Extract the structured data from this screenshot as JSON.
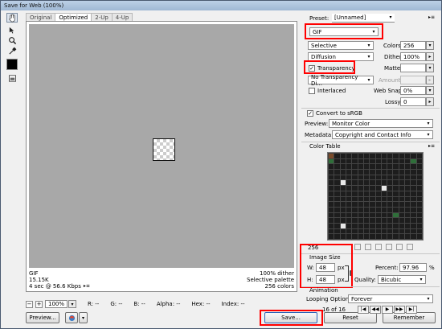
{
  "window": {
    "title": "Save for Web (100%)"
  },
  "tabs": [
    {
      "label": "Original"
    },
    {
      "label": "Optimized"
    },
    {
      "label": "2-Up"
    },
    {
      "label": "4-Up"
    }
  ],
  "info": {
    "format": "GIF",
    "size": "15.15K",
    "time": "4 sec @ 56.6 Kbps",
    "menu_glyph": "▸≡",
    "dither": "100% dither",
    "palette": "Selective palette",
    "colors": "256 colors"
  },
  "status": {
    "zoom": "100%",
    "r": "R: --",
    "g": "G: --",
    "b": "B: --",
    "alpha": "Alpha: --",
    "hex": "Hex: --",
    "index": "Index: --"
  },
  "buttons": {
    "preview": "Preview...",
    "save": "Save...",
    "reset": "Reset",
    "remember": "Remember"
  },
  "settings": {
    "preset_label": "Preset:",
    "preset_value": "[Unnamed]",
    "format": "GIF",
    "reduction": "Selective",
    "colors_label": "Colors:",
    "colors_value": "256",
    "dither_algo": "Diffusion",
    "dither_label": "Dither:",
    "dither_value": "100%",
    "transparency": "Transparency",
    "matte_label": "Matte:",
    "trans_dither": "No Transparency Di...",
    "amount_label": "Amount:",
    "interlaced": "Interlaced",
    "websnap_label": "Web Snap:",
    "websnap_value": "0%",
    "lossy_label": "Lossy:",
    "lossy_value": "0",
    "convert_srgb": "Convert to sRGB",
    "preview_label": "Preview:",
    "preview_value": "Monitor Color",
    "metadata_label": "Metadata:",
    "metadata_value": "Copyright and Contact Info"
  },
  "color_table": {
    "title": "Color Table",
    "count": "256",
    "colors": [
      "#1d1d1d",
      "#f2c230",
      "#3a7cc6",
      "#f3f3f3",
      "#7a4b2a",
      "#c63c2a",
      "#6bb0d9",
      "#f0a830",
      "#2f6f3a",
      "#e8e8e8",
      "#9a6a3a",
      "#d44a8a",
      "#5ab7c8",
      "#f4d27a",
      "#2a2a55",
      "#f7f7f7"
    ]
  },
  "image_size": {
    "title": "Image Size",
    "w_label": "W:",
    "w_value": "48",
    "h_label": "H:",
    "h_value": "48",
    "unit": "px",
    "percent_label": "Percent:",
    "percent_value": "97.96",
    "percent_unit": "%",
    "quality_label": "Quality:",
    "quality_value": "Bicubic"
  },
  "animation": {
    "title": "Animation",
    "loop_label": "Looping Options:",
    "loop_value": "Forever",
    "frames": "16 of 16"
  }
}
